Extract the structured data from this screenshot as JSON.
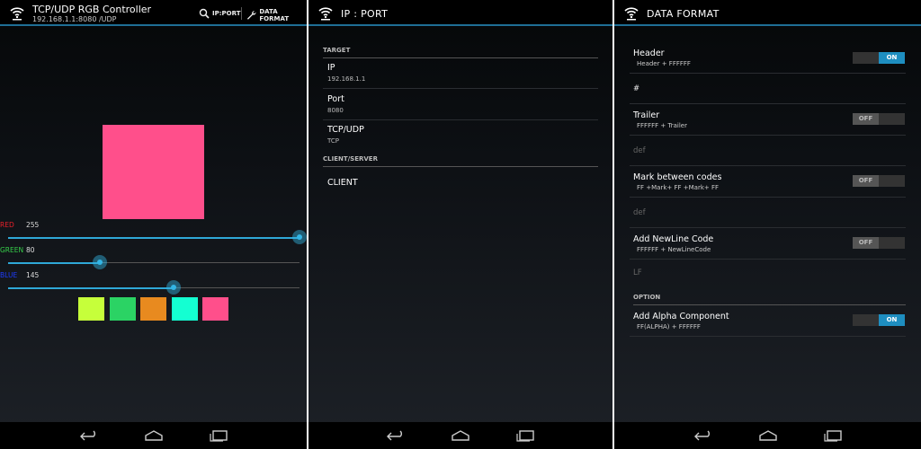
{
  "colors": {
    "accent": "#33b5e5",
    "preview": "#ff4f8b",
    "toggle_on": "#1e8ec0"
  },
  "panel1": {
    "title": "TCP/UDP RGB Controller",
    "subtitle": "192.168.1.1:8080 /UDP",
    "actions": [
      {
        "label": "IP:PORT",
        "icon": "search-icon"
      },
      {
        "label": "DATA FORMAT",
        "icon": "wrench-icon"
      }
    ],
    "sliders": [
      {
        "label": "RED",
        "value": 255,
        "max": 255,
        "color": "#e8202a"
      },
      {
        "label": "GREEN",
        "value": 80,
        "max": 255,
        "color": "#36d04a"
      },
      {
        "label": "BLUE",
        "value": 145,
        "max": 255,
        "color": "#1e3cff"
      }
    ],
    "swatches": [
      "#c6ff3a",
      "#2bd364",
      "#e88a1f",
      "#14ffd2",
      "#ff4f8b"
    ]
  },
  "panel2": {
    "title": "IP : PORT",
    "target_header": "TARGET",
    "client_server_header": "CLIENT/SERVER",
    "items": [
      {
        "title": "IP",
        "summary": "192.168.1.1"
      },
      {
        "title": "Port",
        "summary": "8080"
      },
      {
        "title": "TCP/UDP",
        "summary": "TCP"
      }
    ],
    "mode": "CLIENT"
  },
  "panel3": {
    "title": "DATA FORMAT",
    "header": {
      "title": "Header",
      "summary": "Header + FFFFFF",
      "state": "ON"
    },
    "header_value": "#",
    "trailer": {
      "title": "Trailer",
      "summary": "FFFFFF + Trailer",
      "state": "OFF"
    },
    "trailer_value": "def",
    "mark": {
      "title": "Mark between codes",
      "summary": "FF +Mark+ FF +Mark+ FF",
      "state": "OFF"
    },
    "mark_value": "def",
    "newline": {
      "title": "Add NewLine Code",
      "summary": "FFFFFF + NewLineCode",
      "state": "OFF"
    },
    "newline_value": "LF",
    "option_header": "OPTION",
    "alpha": {
      "title": "Add Alpha Component",
      "summary": "FF(ALPHA) + FFFFFF",
      "state": "ON"
    }
  }
}
